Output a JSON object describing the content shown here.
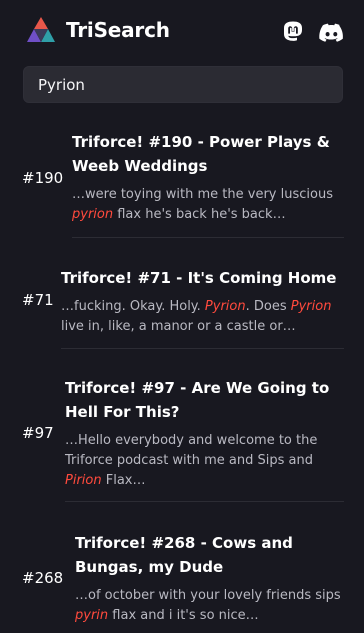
{
  "header": {
    "title": "TriSearch",
    "logo": "trisearch-triangle-logo",
    "icons": [
      "mastodon-icon",
      "discord-icon"
    ]
  },
  "search": {
    "value": "Pyrion"
  },
  "results": [
    {
      "number": "#190",
      "title": "Triforce! #190 - Power Plays & Weeb Weddings",
      "snippet_before": "…were toying with me the very luscious ",
      "highlight1": "pyrion",
      "snippet_mid": " flax he's back he's back…",
      "highlight2": "",
      "snippet_after": ""
    },
    {
      "number": "#71",
      "title": "Triforce! #71 - It's Coming Home",
      "snippet_before": "…fucking. Okay. Holy. ",
      "highlight1": "Pyrion",
      "snippet_mid": ". Does ",
      "highlight2": "Pyrion",
      "snippet_after": " live in, like, a manor or a castle or…"
    },
    {
      "number": "#97",
      "title": "Triforce! #97 - Are We Going to Hell For This?",
      "snippet_before": "…Hello everybody and welcome to the Triforce podcast with me and Sips and ",
      "highlight1": "Pirion",
      "snippet_mid": " Flax…",
      "highlight2": "",
      "snippet_after": ""
    },
    {
      "number": "#268",
      "title": "Triforce! #268 - Cows and Bungas, my Dude",
      "snippet_before": "…of october with your lovely friends sips ",
      "highlight1": "pyrin",
      "snippet_mid": " flax and i it's so nice…",
      "highlight2": "",
      "snippet_after": ""
    }
  ],
  "colors": {
    "background": "#181820",
    "highlight": "#ff4a3d",
    "search_bg": "#2b2b33",
    "logo_red": "#e8574a",
    "logo_purple": "#6f4fc6",
    "logo_teal": "#2f9fa8"
  }
}
